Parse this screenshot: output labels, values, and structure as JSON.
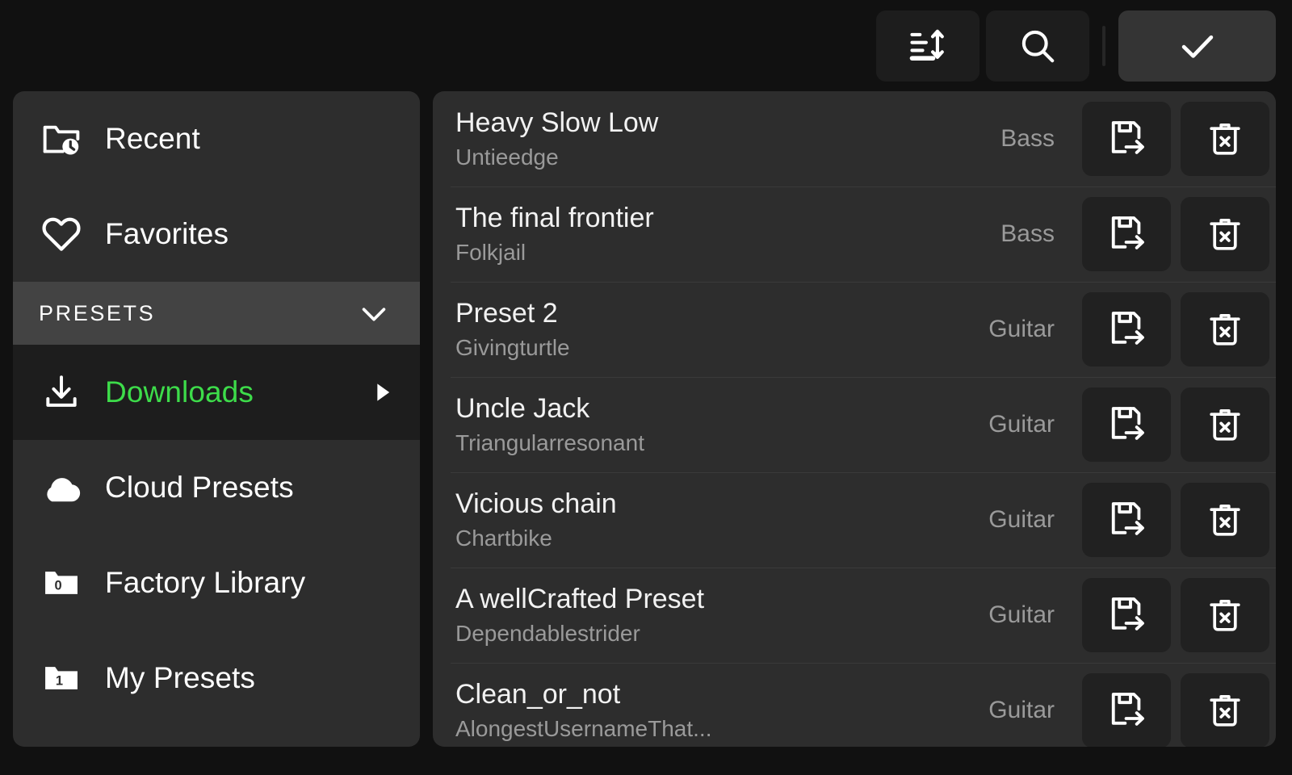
{
  "toolbar": {
    "sort_button": {
      "icon": "sort-lines-icon",
      "label": "Sort"
    },
    "search_button": {
      "icon": "search-icon",
      "label": "Search"
    },
    "confirm_button": {
      "icon": "check-icon",
      "label": "Confirm"
    }
  },
  "colors": {
    "page_background": "#111111",
    "panel_background": "#2d2d2d",
    "section_header_background": "#434343",
    "active_row_background": "#1d1d1d",
    "accent_green": "#3ddc4a",
    "button_background": "#212121",
    "confirm_button_background": "#343434",
    "primary_text": "#f2f2f2",
    "secondary_text": "#9a9a9a",
    "separator": "#3a3a3a"
  },
  "sidebar": {
    "items": [
      {
        "label": "Recent",
        "icon": "folder-clock-icon",
        "state": "normal"
      },
      {
        "label": "Favorites",
        "icon": "heart-icon",
        "state": "normal"
      }
    ],
    "section": {
      "label": "PRESETS",
      "icon": "chevron-down-icon",
      "expanded": true
    },
    "preset_items": [
      {
        "label": "Downloads",
        "icon": "download-icon",
        "state": "selected",
        "caret": "caret-right-icon",
        "badge": ""
      },
      {
        "label": "Cloud Presets",
        "icon": "cloud-icon",
        "state": "normal",
        "badge": ""
      },
      {
        "label": "Factory Library",
        "icon": "folder-count-icon",
        "state": "normal",
        "badge": "0"
      },
      {
        "label": "My Presets",
        "icon": "folder-count-icon",
        "state": "normal",
        "badge": "1"
      }
    ]
  },
  "list": {
    "row_actions": {
      "save_icon": "save-export-icon",
      "delete_icon": "trash-delete-icon"
    },
    "rows": [
      {
        "title": "Heavy Slow Low",
        "author": "Untieedge",
        "category": "Bass"
      },
      {
        "title": "The final frontier",
        "author": "Folkjail",
        "category": "Bass"
      },
      {
        "title": "Preset 2",
        "author": "Givingturtle",
        "category": "Guitar"
      },
      {
        "title": "Uncle Jack",
        "author": "Triangularresonant",
        "category": "Guitar"
      },
      {
        "title": "Vicious chain",
        "author": "Chartbike",
        "category": "Guitar"
      },
      {
        "title": "A wellCrafted Preset",
        "author": "Dependablestrider",
        "category": "Guitar"
      },
      {
        "title": "Clean_or_not",
        "author": "AlongestUsernameThat...",
        "category": "Guitar"
      }
    ]
  }
}
